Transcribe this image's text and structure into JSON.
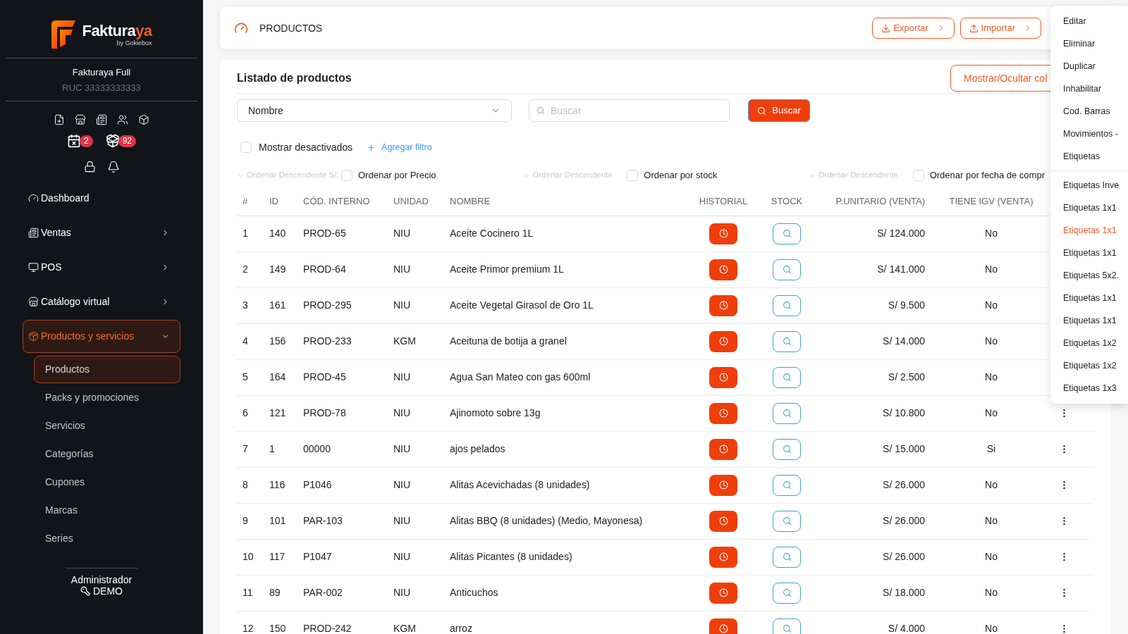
{
  "sidebar": {
    "logo": {
      "name": "Faktura",
      "name_accent": "ya",
      "tagline": "by Gokiebox"
    },
    "company": {
      "name": "Fakturaya Full",
      "ruc": "RUC 33333333333"
    },
    "badges": [
      {
        "count": "2"
      },
      {
        "count": "92"
      }
    ],
    "nav": [
      {
        "label": "Dashboard",
        "selected": false
      },
      {
        "label": "Ventas",
        "expanded": false,
        "selected": false
      },
      {
        "label": "POS",
        "expanded": false,
        "selected": false
      },
      {
        "label": "Catálogo virtual",
        "expanded": false,
        "selected": false
      },
      {
        "label": "Productos y servicios",
        "expanded": true,
        "selected": true,
        "children": [
          {
            "label": "Productos",
            "selected": true
          },
          {
            "label": "Packs y promociones",
            "selected": false
          },
          {
            "label": "Servicios",
            "selected": false
          },
          {
            "label": "Categorías",
            "selected": false
          },
          {
            "label": "Cupones",
            "selected": false
          },
          {
            "label": "Marcas",
            "selected": false
          },
          {
            "label": "Series",
            "selected": false
          }
        ]
      }
    ],
    "user": {
      "role": "Administrador",
      "name": "DEMO"
    }
  },
  "header": {
    "title": "PRODUCTOS",
    "buttons": [
      "Exportar",
      "Importar"
    ]
  },
  "list": {
    "title": "Listado de productos",
    "columns_button": "Mostrar/Ocultar col",
    "filter_field": {
      "value": "Nombre"
    },
    "search": {
      "placeholder": "Buscar"
    },
    "search_button": "Buscar",
    "show_disabled": {
      "label": "Mostrar desactivados",
      "checked": false
    },
    "add_filter": "Agregar filtro",
    "sorts": [
      {
        "direction": "Ordenar Descendente S/.",
        "disabled": true,
        "label": "Ordenar por Precio",
        "checked": false
      },
      {
        "direction": "Ordenar Descendente",
        "disabled": true,
        "label": "Ordenar por stock",
        "checked": false
      },
      {
        "direction": "Ordenar Descendente",
        "disabled": true,
        "label": "Ordenar por fecha de compr",
        "checked": false
      }
    ]
  },
  "table": {
    "columns": [
      "#",
      "ID",
      "CÓD. INTERNO",
      "UNIDAD",
      "NOMBRE",
      "HISTORIAL",
      "STOCK",
      "P.UNITARIO (VENTA)",
      "TIENE IGV (VENTA)"
    ],
    "rows": [
      {
        "num": "1",
        "id": "140",
        "code": "PROD-65",
        "unit": "NIU",
        "name": "Aceite Cocinero 1L",
        "price": "S/ 124.000",
        "igv": "No"
      },
      {
        "num": "2",
        "id": "149",
        "code": "PROD-64",
        "unit": "NIU",
        "name": "Aceite Primor premium 1L",
        "price": "S/ 141.000",
        "igv": "No"
      },
      {
        "num": "3",
        "id": "161",
        "code": "PROD-295",
        "unit": "NIU",
        "name": "Aceite Vegetal Girasol de Oro 1L",
        "price": "S/ 9.500",
        "igv": "No"
      },
      {
        "num": "4",
        "id": "156",
        "code": "PROD-233",
        "unit": "KGM",
        "name": "Aceituna de botija a granel",
        "price": "S/ 14.000",
        "igv": "No"
      },
      {
        "num": "5",
        "id": "164",
        "code": "PROD-45",
        "unit": "NIU",
        "name": "Agua San Mateo con gas 600ml",
        "price": "S/ 2.500",
        "igv": "No"
      },
      {
        "num": "6",
        "id": "121",
        "code": "PROD-78",
        "unit": "NIU",
        "name": "Ajinomoto sobre 13g",
        "price": "S/ 10.800",
        "igv": "No"
      },
      {
        "num": "7",
        "id": "1",
        "code": "00000",
        "unit": "NIU",
        "name": "ajos pelados",
        "price": "S/ 15.000",
        "igv": "Si"
      },
      {
        "num": "8",
        "id": "116",
        "code": "P1046",
        "unit": "NIU",
        "name": "Alitas Acevichadas (8 unidades)",
        "price": "S/ 26.000",
        "igv": "No"
      },
      {
        "num": "9",
        "id": "101",
        "code": "PAR-103",
        "unit": "NIU",
        "name": "Alitas BBQ (8 unidades) (Medio, Mayonesa)",
        "price": "S/ 26.000",
        "igv": "No"
      },
      {
        "num": "10",
        "id": "117",
        "code": "P1047",
        "unit": "NIU",
        "name": "Alitas Picantes (8 unidades)",
        "price": "S/ 26.000",
        "igv": "No"
      },
      {
        "num": "11",
        "id": "89",
        "code": "PAR-002",
        "unit": "NIU",
        "name": "Anticuchos",
        "price": "S/ 18.000",
        "igv": "No"
      },
      {
        "num": "12",
        "id": "150",
        "code": "PROD-242",
        "unit": "KGM",
        "name": "arroz",
        "price": "S/ 4.000",
        "igv": "No"
      }
    ]
  },
  "menu": {
    "groups": [
      [
        {
          "label": "Editar",
          "selected": false
        },
        {
          "label": "Eliminar",
          "selected": false
        },
        {
          "label": "Duplicar",
          "selected": false
        },
        {
          "label": "Inhabilitar",
          "selected": false
        },
        {
          "label": "Cod. Barras",
          "selected": false
        },
        {
          "label": "Movimientos -",
          "selected": false
        },
        {
          "label": "Etiquetas",
          "selected": false
        }
      ],
      [
        {
          "label": "Etiquetas Inve",
          "selected": false
        },
        {
          "label": "Etiquetas 1x1",
          "selected": false
        },
        {
          "label": "Etiquetas 1x1",
          "selected": true
        },
        {
          "label": "Etiquetas 1x1",
          "selected": false
        },
        {
          "label": "Etiquetas 5x2.",
          "selected": false
        },
        {
          "label": "Etiquetas 1x1",
          "selected": false
        },
        {
          "label": "Etiquetas 1x1",
          "selected": false
        },
        {
          "label": "Etiquetas 1x2",
          "selected": false
        },
        {
          "label": "Etiquetas 1x2",
          "selected": false
        },
        {
          "label": "Etiquetas 1x3",
          "selected": false
        }
      ]
    ]
  }
}
